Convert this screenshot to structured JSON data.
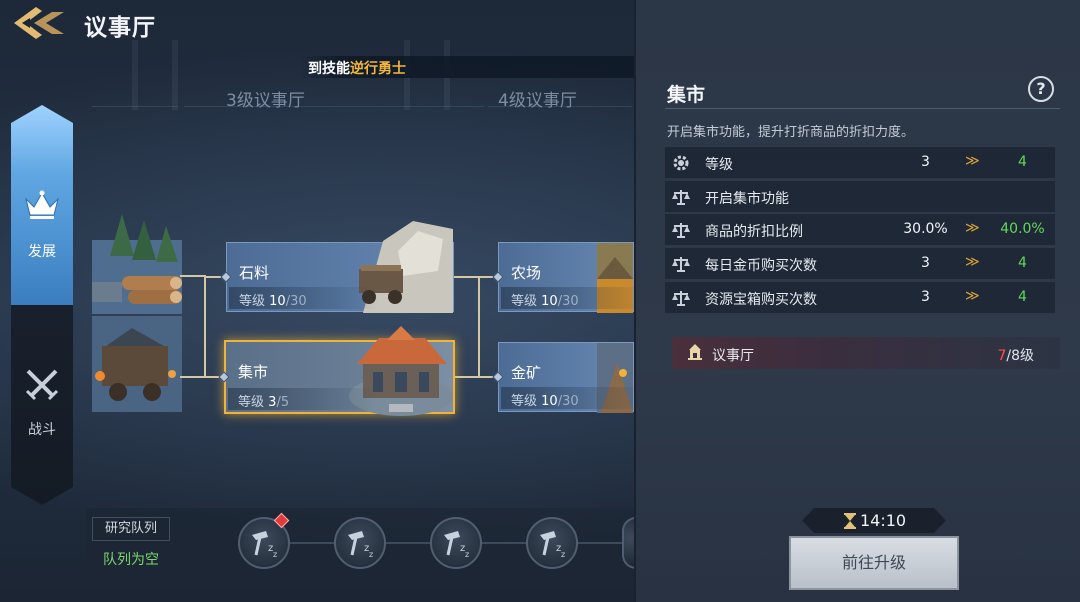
{
  "header": {
    "title": "议事厅"
  },
  "marquee": {
    "text_prefix": "到技能",
    "text_highlight": "逆行勇士"
  },
  "tiers": [
    {
      "label": "3级议事厅"
    },
    {
      "label": "4级议事厅"
    }
  ],
  "nav": {
    "development": "发展",
    "battle": "战斗"
  },
  "buildings": {
    "level_prefix": "等级",
    "stone": {
      "name": "石料",
      "level": "10",
      "max": "/30"
    },
    "market": {
      "name": "集市",
      "level": "3",
      "max": "/5"
    },
    "farm": {
      "name": "农场",
      "level": "10",
      "max": "/30"
    },
    "gold": {
      "name": "金矿",
      "level": "10",
      "max": "/30"
    }
  },
  "queue": {
    "title": "研究队列",
    "status": "队列为空"
  },
  "panel": {
    "title": "集市",
    "help": "?",
    "description": "开启集市功能，提升打折商品的折扣力度。",
    "stats": [
      {
        "icon": "gear-icon",
        "label": "等级",
        "current": "3",
        "next": "4"
      },
      {
        "icon": "scale-icon",
        "label": "开启集市功能",
        "current": "",
        "next": ""
      },
      {
        "icon": "scale-icon",
        "label": "商品的折扣比例",
        "current": "30.0%",
        "next": "40.0%"
      },
      {
        "icon": "scale-icon",
        "label": "每日金币购买次数",
        "current": "3",
        "next": "4"
      },
      {
        "icon": "scale-icon",
        "label": "资源宝箱购买次数",
        "current": "3",
        "next": "4"
      }
    ],
    "arrow": "≫",
    "requirement": {
      "label": "议事厅",
      "current": "7",
      "required": "/8级"
    },
    "timer": "14:10",
    "upgrade_button": "前往升级"
  },
  "colors": {
    "accent_gold": "#f0b338",
    "highlight_orange": "#f3b53c",
    "next_value_green": "#62d85a",
    "requirement_red": "#ff4d4d",
    "queue_status_green": "#7cd86c"
  }
}
